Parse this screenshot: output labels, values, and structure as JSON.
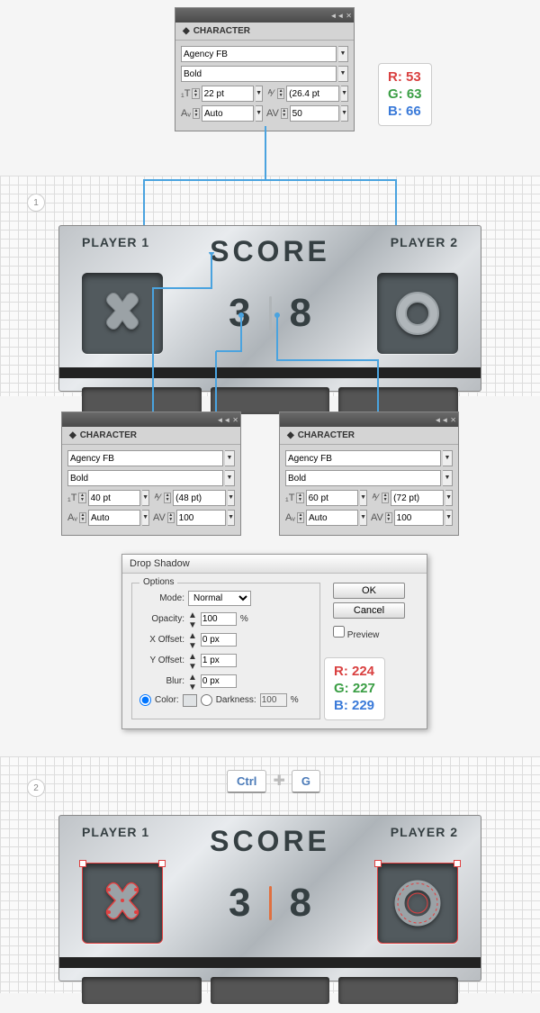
{
  "panel_top": {
    "title": "CHARACTER",
    "font": "Agency FB",
    "weight": "Bold",
    "size": "22 pt",
    "leading": "(26.4 pt",
    "kerning": "Auto",
    "tracking": "50"
  },
  "rgb_top": {
    "r": "R: 53",
    "g": "G: 63",
    "b": "B: 66"
  },
  "step1": "1",
  "step2": "2",
  "metal1": {
    "p1": "PLAYER 1",
    "p2": "PLAYER 2",
    "score_label": "SCORE",
    "score_left": "3",
    "score_right": "8"
  },
  "panel_left": {
    "title": "CHARACTER",
    "font": "Agency FB",
    "weight": "Bold",
    "size": "40 pt",
    "leading": "(48 pt)",
    "kerning": "Auto",
    "tracking": "100"
  },
  "panel_right": {
    "title": "CHARACTER",
    "font": "Agency FB",
    "weight": "Bold",
    "size": "60 pt",
    "leading": "(72 pt)",
    "kerning": "Auto",
    "tracking": "100"
  },
  "dropshadow": {
    "title": "Drop Shadow",
    "options_label": "Options",
    "mode_label": "Mode:",
    "mode": "Normal",
    "opacity_label": "Opacity:",
    "opacity": "100",
    "pct": "%",
    "xoff_label": "X Offset:",
    "xoff": "0 px",
    "yoff_label": "Y Offset:",
    "yoff": "1 px",
    "blur_label": "Blur:",
    "blur": "0 px",
    "color_label": "Color:",
    "darkness_label": "Darkness:",
    "darkness": "100",
    "ok": "OK",
    "cancel": "Cancel",
    "preview": "Preview"
  },
  "rgb_ds": {
    "r": "R: 224",
    "g": "G: 227",
    "b": "B: 229"
  },
  "keys": {
    "ctrl": "Ctrl",
    "g": "G"
  },
  "metal2": {
    "p1": "PLAYER 1",
    "p2": "PLAYER 2",
    "score_label": "SCORE",
    "score_left": "3",
    "score_right": "8"
  }
}
